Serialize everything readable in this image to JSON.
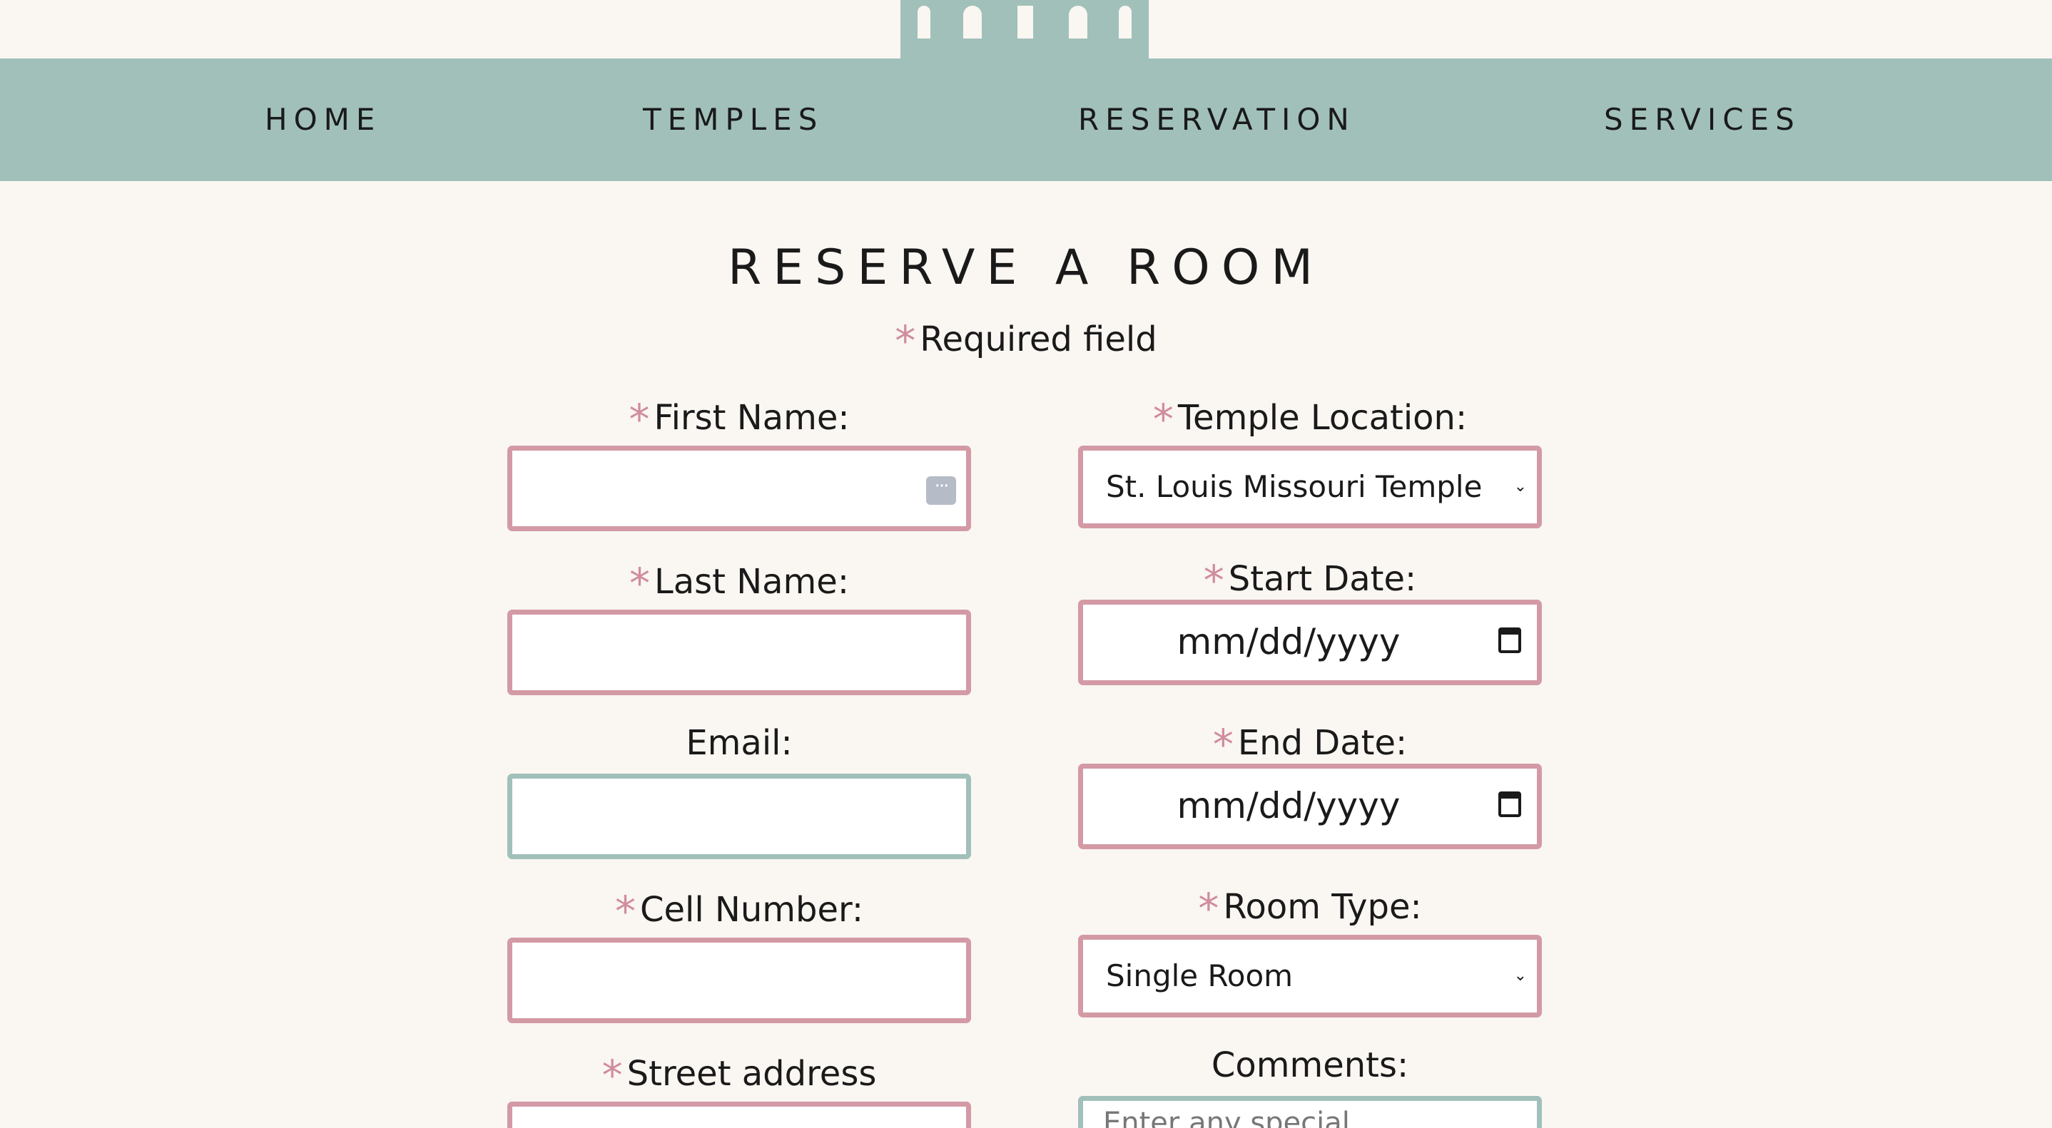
{
  "nav": {
    "items": [
      {
        "label": "HOME"
      },
      {
        "label": "TEMPLES"
      },
      {
        "label": "RESERVATION"
      },
      {
        "label": "SERVICES"
      }
    ]
  },
  "form": {
    "title": "RESERVE A ROOM",
    "required_note": "Required field",
    "required_marker": "*",
    "first_name": {
      "label": "First Name:",
      "value": ""
    },
    "last_name": {
      "label": "Last Name:",
      "value": ""
    },
    "email": {
      "label": "Email:",
      "value": ""
    },
    "cell": {
      "label": "Cell Number:",
      "value": ""
    },
    "street": {
      "label": "Street address",
      "value": ""
    },
    "temple_location": {
      "label": "Temple Location:",
      "selected": "St. Louis Missouri Temple"
    },
    "start_date": {
      "label": "Start Date:",
      "placeholder": "mm/dd/yyyy"
    },
    "end_date": {
      "label": "End Date:",
      "placeholder": "mm/dd/yyyy"
    },
    "room_type": {
      "label": "Room Type:",
      "selected": "Single Room"
    },
    "comments": {
      "label": "Comments:",
      "placeholder": "Enter any special"
    }
  },
  "icons": {
    "logo": "castle-logo",
    "calendar": "calendar-icon",
    "dropdown": "chevron-down-icon",
    "autofill": "password-manager-icon"
  },
  "colors": {
    "background": "#faf6f2",
    "nav": "#a1c0ba",
    "required_border": "#d39aa5",
    "optional_border": "#a1c0ba",
    "asterisk": "#d08d9c"
  }
}
